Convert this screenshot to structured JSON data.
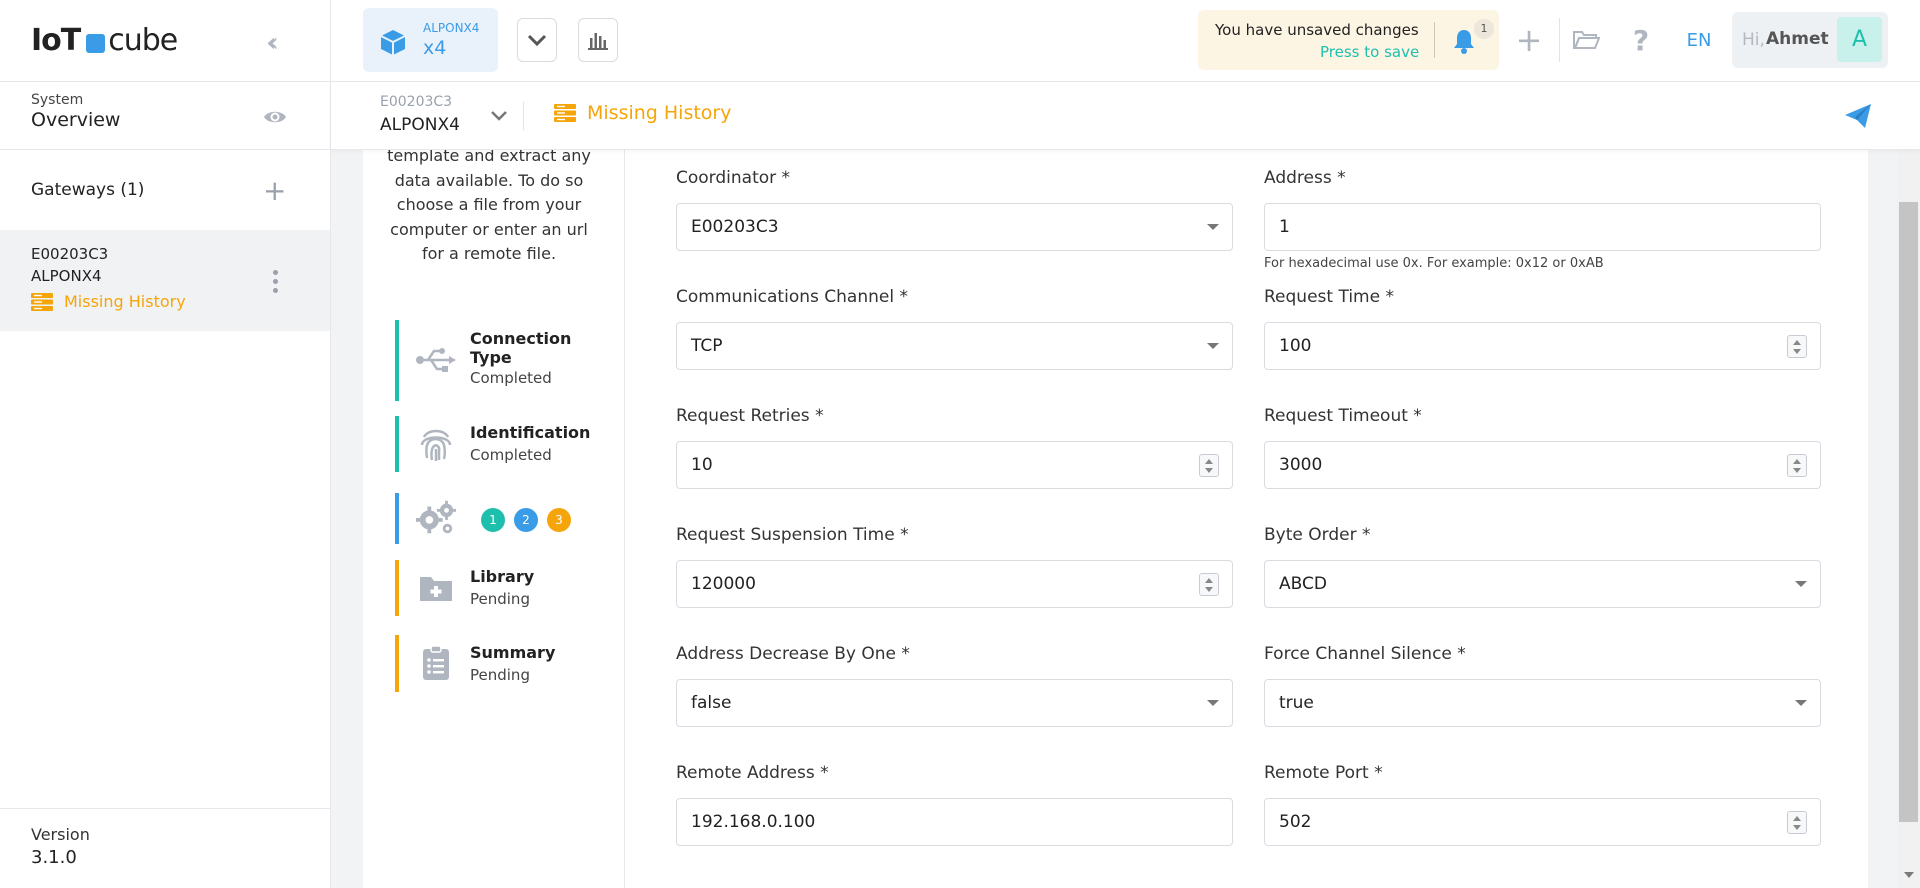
{
  "sidebar": {
    "logo_text_bold": "IoT",
    "logo_text": "cube",
    "collapse_icon": "double-chevron-left-icon",
    "overview_small": "System",
    "overview_big": "Overview",
    "gateways_label": "Gateways (1)",
    "gateway": {
      "id": "E00203C3",
      "name": "ALPONX4",
      "status": "Missing History"
    },
    "version_label": "Version",
    "version_value": "3.1.0"
  },
  "topbar": {
    "device_small": "ALPONX4",
    "device_big": "x4",
    "unsaved_title": "You have unsaved changes",
    "unsaved_action": "Press to save",
    "notification_count": "1",
    "language": "EN",
    "user_greeting": "Hi,",
    "user_name": "Ahmet",
    "user_initial": "A"
  },
  "subbar": {
    "device_id": "E00203C3",
    "device_name": "ALPONX4",
    "status": "Missing History"
  },
  "wizard": {
    "intro": "template and extract any data available. To do so choose a file from your computer or enter an url for a remote file.",
    "steps": [
      {
        "title_line1": "Connection",
        "title_line2": "Type",
        "status": "Completed",
        "color": "#1fbfae"
      },
      {
        "title": "Identification",
        "status": "Completed",
        "color": "#1fbfae"
      },
      {
        "dots": [
          "1",
          "2",
          "3"
        ],
        "dot_colors": [
          "#1fbfae",
          "#3a9be6",
          "#f5a50a"
        ],
        "color": "#3a9be6"
      },
      {
        "title": "Library",
        "status": "Pending",
        "color": "#f5a50a"
      },
      {
        "title": "Summary",
        "status": "Pending",
        "color": "#f5a50a"
      }
    ]
  },
  "form": {
    "coordinator": {
      "label": "Coordinator *",
      "value": "E00203C3"
    },
    "address": {
      "label": "Address *",
      "value": "1",
      "hint": "For hexadecimal use 0x. For example: 0x12 or 0xAB"
    },
    "channel": {
      "label": "Communications Channel *",
      "value": "TCP"
    },
    "request_time": {
      "label": "Request Time *",
      "value": "100"
    },
    "request_retries": {
      "label": "Request Retries *",
      "value": "10"
    },
    "request_timeout": {
      "label": "Request Timeout *",
      "value": "3000"
    },
    "suspension_time": {
      "label": "Request Suspension Time *",
      "value": "120000"
    },
    "byte_order": {
      "label": "Byte Order *",
      "value": "ABCD"
    },
    "address_decrease": {
      "label": "Address Decrease By One *",
      "value": "false"
    },
    "force_silence": {
      "label": "Force Channel Silence *",
      "value": "true"
    },
    "remote_address": {
      "label": "Remote Address *",
      "value": "192.168.0.100"
    },
    "remote_port": {
      "label": "Remote Port *",
      "value": "502"
    }
  },
  "colors": {
    "accent_blue": "#3a9be6",
    "accent_teal": "#1fbfae",
    "accent_orange": "#f5a50a"
  }
}
